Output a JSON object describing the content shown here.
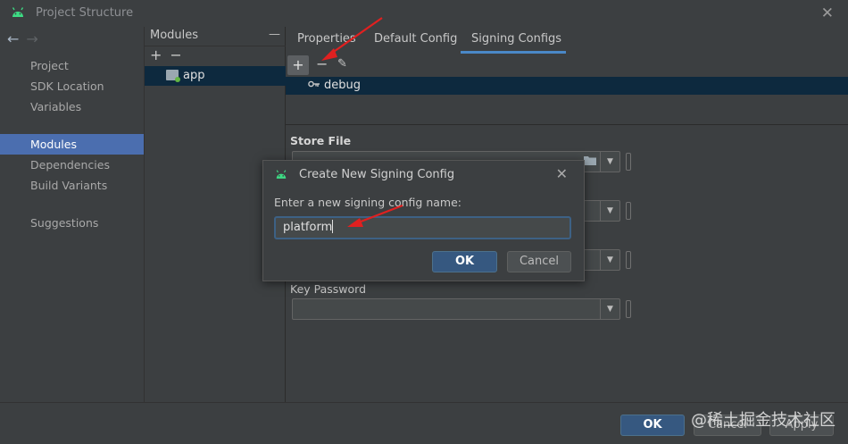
{
  "window": {
    "title": "Project Structure",
    "close_glyph": "✕"
  },
  "nav": {
    "back_glyph": "←",
    "forward_glyph": "→",
    "items": [
      {
        "label": "Project",
        "selected": false
      },
      {
        "label": "SDK Location",
        "selected": false
      },
      {
        "label": "Variables",
        "selected": false
      },
      {
        "label": "Modules",
        "selected": true
      },
      {
        "label": "Dependencies",
        "selected": false
      },
      {
        "label": "Build Variants",
        "selected": false
      },
      {
        "label": "Suggestions",
        "selected": false
      }
    ]
  },
  "modules": {
    "header": "Modules",
    "collapse_glyph": "—",
    "add_glyph": "+",
    "remove_glyph": "−",
    "items": [
      {
        "label": "app",
        "selected": true
      }
    ]
  },
  "tabs": [
    {
      "label": "Properties",
      "active": false
    },
    {
      "label": "Default Config",
      "active": false
    },
    {
      "label": "Signing Configs",
      "active": true
    }
  ],
  "signing": {
    "add_glyph": "+",
    "remove_glyph": "−",
    "edit_glyph": "✎",
    "items": [
      {
        "label": "debug",
        "selected": true
      }
    ]
  },
  "form": {
    "store_file_label": "Store File",
    "key_password_label": "Key Password",
    "dropdown_glyph": "▼"
  },
  "footer": {
    "ok_label": "OK",
    "cancel_label": "Cancel",
    "apply_label": "Apply"
  },
  "dialog": {
    "title": "Create New Signing Config",
    "close_glyph": "✕",
    "prompt": "Enter a new signing config name:",
    "input_value": "platform",
    "ok_label": "OK",
    "cancel_label": "Cancel"
  },
  "watermark": "@稀土掘金技术社区",
  "colors": {
    "accent": "#4b6eaf",
    "primary_button": "#365880",
    "annotation_arrow": "#e02020",
    "android_green": "#3ddc84"
  }
}
